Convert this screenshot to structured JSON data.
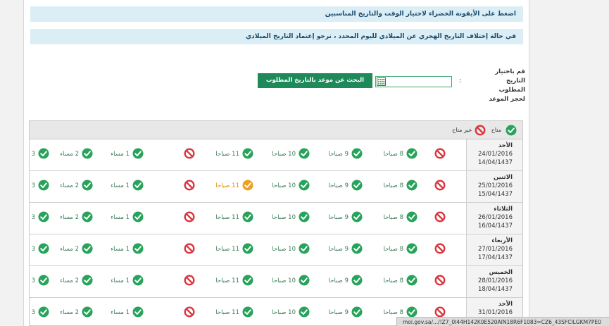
{
  "banners": {
    "click_instruction": "اضغط على الأيقونة الخضراء لاختيار الوقت والتاريخ المناسبين",
    "hijri_notice": "في حالة إختلاف التاريخ الهجري عن الميلادي لليوم المحدد ، نرجو إعتماد التاريخ الميلادي"
  },
  "date_picker": {
    "label": "قم باختيار التاريخ المطلوب لحجز الموعد",
    "colon": ":",
    "value": "",
    "calendar_icon": "calendar-icon"
  },
  "search_button": "البحث عن موعد بالتاريخ المطلوب",
  "legend": {
    "available": "متاح",
    "unavailable": "غير متاح"
  },
  "colors": {
    "available": "#27a35a",
    "unavailable": "#d9363e",
    "limited": "#f0a020",
    "button": "#1e8a5a",
    "banner": "#dceef5"
  },
  "slot_labels": [
    "8 صباحا",
    "9 صباحا",
    "10 صباحا",
    "11 صباحا",
    "",
    "1 مساء",
    "2 مساء",
    "3 مساء"
  ],
  "days": [
    {
      "name": "الأحد",
      "greg": "24/01/2016",
      "hijri": "14/04/1437",
      "statuses": [
        "unavailable",
        "available",
        "available",
        "available",
        "available",
        "unavailable",
        "available",
        "available",
        "available"
      ]
    },
    {
      "name": "الاثنين",
      "greg": "25/01/2016",
      "hijri": "15/04/1437",
      "statuses": [
        "unavailable",
        "available",
        "available",
        "available",
        "limited",
        "unavailable",
        "available",
        "available",
        "available"
      ]
    },
    {
      "name": "الثلاثاء",
      "greg": "26/01/2016",
      "hijri": "16/04/1437",
      "statuses": [
        "unavailable",
        "available",
        "available",
        "available",
        "available",
        "unavailable",
        "available",
        "available",
        "available"
      ]
    },
    {
      "name": "الأربعاء",
      "greg": "27/01/2016",
      "hijri": "17/04/1437",
      "statuses": [
        "unavailable",
        "available",
        "available",
        "available",
        "available",
        "unavailable",
        "available",
        "available",
        "available"
      ]
    },
    {
      "name": "الخميس",
      "greg": "28/01/2016",
      "hijri": "18/04/1437",
      "statuses": [
        "unavailable",
        "available",
        "available",
        "available",
        "available",
        "unavailable",
        "available",
        "available",
        "available"
      ]
    },
    {
      "name": "الأحد",
      "greg": "31/01/2016",
      "hijri": "",
      "statuses": [
        "unavailable",
        "available",
        "available",
        "available",
        "available",
        "unavailable",
        "available",
        "available",
        "available"
      ]
    }
  ],
  "status_bar": "moi.gov.sa/.../!Z7_0I44H142K0E520AIN18R6F1083=CZ6_43SFCILGKM7PE0"
}
